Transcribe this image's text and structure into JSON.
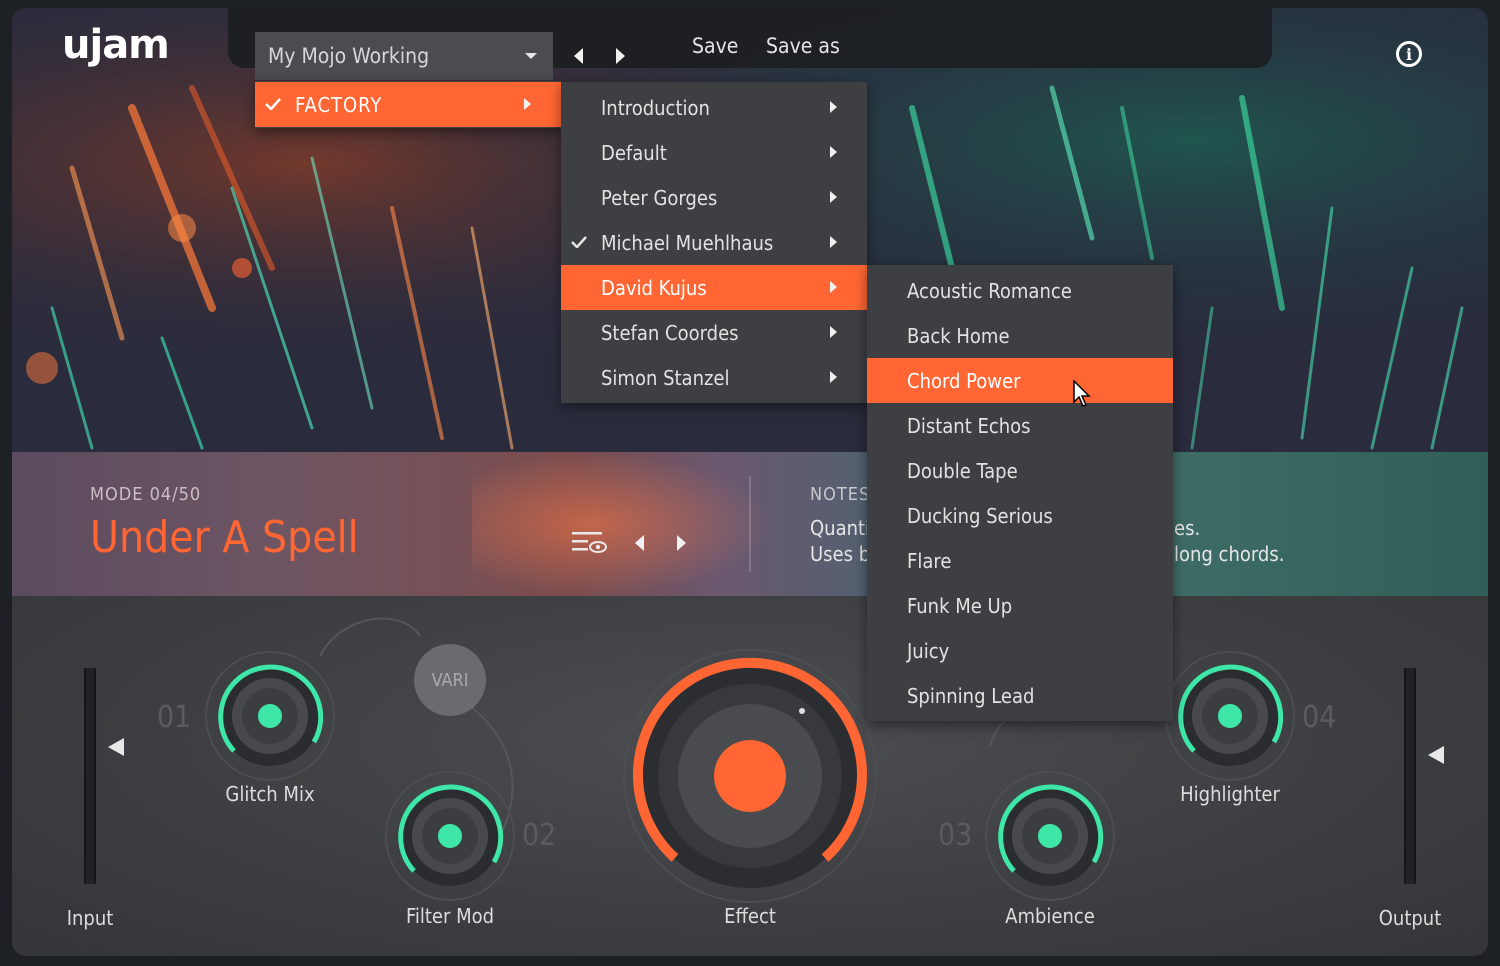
{
  "header": {
    "logo": "ujam",
    "preset_name": "My Mojo Working",
    "save_label": "Save",
    "save_as_label": "Save as"
  },
  "menu_root": {
    "items": [
      {
        "label": "FACTORY",
        "checked": true,
        "has_submenu": true,
        "highlighted": true
      }
    ]
  },
  "menu_factory": {
    "items": [
      {
        "label": "Introduction",
        "has_submenu": true
      },
      {
        "label": "Default",
        "has_submenu": true
      },
      {
        "label": "Peter Gorges",
        "has_submenu": true
      },
      {
        "label": "Michael Muehlhaus",
        "has_submenu": true,
        "checked": true
      },
      {
        "label": "David Kujus",
        "has_submenu": true,
        "highlighted": true
      },
      {
        "label": "Stefan Coordes",
        "has_submenu": true
      },
      {
        "label": "Simon Stanzel",
        "has_submenu": true
      }
    ]
  },
  "menu_presets": {
    "items": [
      {
        "label": "Acoustic Romance"
      },
      {
        "label": "Back Home"
      },
      {
        "label": "Chord Power",
        "highlighted": true
      },
      {
        "label": "Distant Echos"
      },
      {
        "label": "Double Tape"
      },
      {
        "label": "Ducking Serious"
      },
      {
        "label": "Flare"
      },
      {
        "label": "Funk Me Up"
      },
      {
        "label": "Juicy"
      },
      {
        "label": "Spinning Lead"
      }
    ]
  },
  "mode": {
    "number": "MODE 04/50",
    "name": "Under A Spell"
  },
  "notes": {
    "title": "NOTES",
    "line1_left": "Quanti",
    "line1_right": "es.",
    "line2_left": "Uses b",
    "line2_right": "long chords."
  },
  "controls": {
    "input": {
      "label": "Input"
    },
    "output": {
      "label": "Output"
    },
    "vari": {
      "label": "VARI"
    },
    "effect": {
      "label": "Effect"
    },
    "slots": [
      {
        "number": "01",
        "label": "Glitch Mix"
      },
      {
        "number": "02",
        "label": "Filter Mod"
      },
      {
        "number": "03",
        "label": "Ambience"
      },
      {
        "number": "04",
        "label": "Highlighter"
      }
    ]
  },
  "colors": {
    "accent": "#ff6633",
    "teal": "#3ee6a8",
    "menu_bg": "#3d3f42",
    "panel_bg": "#3d3f42"
  },
  "icons": [
    "info-icon",
    "chevron-down-icon",
    "arrow-left-icon",
    "arrow-right-icon",
    "check-icon",
    "mode-list-icon",
    "mouse-cursor-icon"
  ]
}
